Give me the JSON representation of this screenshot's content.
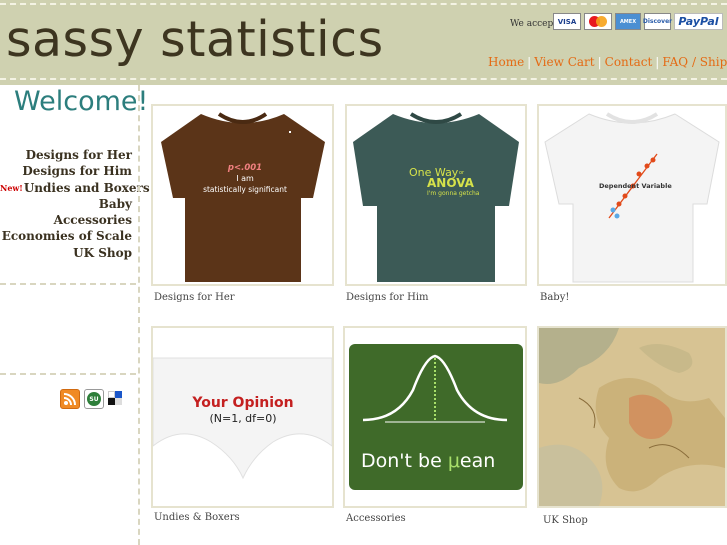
{
  "header": {
    "title": "sassy statistics",
    "we_accept": "We accept",
    "payments": [
      "VISA",
      "MasterCard",
      "AMEX",
      "Discover",
      "PayPal"
    ],
    "nav": [
      "Home",
      "View Cart",
      "Contact",
      "FAQ / Shipping"
    ]
  },
  "sidebar": {
    "welcome": "Welcome!",
    "new_badge": "New!",
    "items": [
      "Designs for Her",
      "Designs for Him",
      "Undies and Boxers",
      "Baby",
      "Accessories",
      "Economies of Scale",
      "UK Shop"
    ]
  },
  "products": [
    {
      "caption": "Designs for Her",
      "shirt_text": [
        "p<.001",
        "I am",
        "statistically significant"
      ]
    },
    {
      "caption": "Designs for Him",
      "shirt_text": [
        "One Way",
        "or",
        "ANOVA",
        "I'm gonna getcha"
      ]
    },
    {
      "caption": "Baby!",
      "shirt_text": [
        "Dependent Variable"
      ]
    },
    {
      "caption": "Undies & Boxers",
      "shirt_text": [
        "Your Opinion",
        "(N=1, df=0)"
      ]
    },
    {
      "caption": "Accessories",
      "shirt_text": [
        "Don't be ",
        "μ",
        "ean"
      ]
    },
    {
      "caption": "UK Shop"
    }
  ],
  "colors": {
    "header_bg": "#cfd1b0",
    "title": "#3d3520",
    "nav_link": "#e46a14",
    "welcome": "#2c7e7d",
    "new_badge": "#cc0000"
  }
}
